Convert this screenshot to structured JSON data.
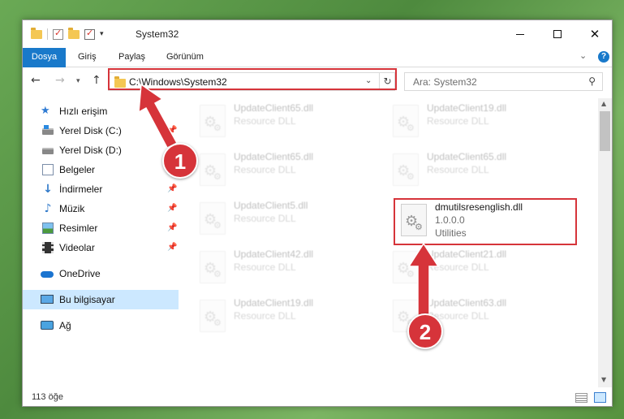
{
  "titlebar": {
    "title": "System32"
  },
  "ribbon": {
    "tabs": [
      "Dosya",
      "Giriş",
      "Paylaş",
      "Görünüm"
    ],
    "help": "?"
  },
  "address": {
    "path": "C:\\Windows\\System32"
  },
  "search": {
    "placeholder": "Ara: System32"
  },
  "sidebar": {
    "items": [
      {
        "label": "Hızlı erişim"
      },
      {
        "label": "Yerel Disk (C:)"
      },
      {
        "label": "Yerel Disk (D:)"
      },
      {
        "label": "Belgeler"
      },
      {
        "label": "İndirmeler"
      },
      {
        "label": "Müzik"
      },
      {
        "label": "Resimler"
      },
      {
        "label": "Videolar"
      },
      {
        "label": "OneDrive"
      },
      {
        "label": "Bu bilgisayar"
      },
      {
        "label": "Ağ"
      }
    ]
  },
  "files": [
    {
      "name": "UpdateClient65.dll",
      "desc": "Resource DLL"
    },
    {
      "name": "UpdateClient19.dll",
      "desc": "Resource DLL"
    },
    {
      "name": "UpdateClient65.dll",
      "desc": "Resource DLL"
    },
    {
      "name": "UpdateClient65.dll",
      "desc": "Resource DLL"
    },
    {
      "name": "UpdateClient5.dll",
      "desc": "Resource DLL"
    },
    {
      "name": "dmutilsresenglish.dll",
      "desc": "1.0.0.0",
      "desc2": "Utilities"
    },
    {
      "name": "UpdateClient42.dll",
      "desc": "Resource DLL"
    },
    {
      "name": "UpdateClient21.dll",
      "desc": "Resource DLL"
    },
    {
      "name": "UpdateClient19.dll",
      "desc": "Resource DLL"
    },
    {
      "name": "UpdateClient63.dll",
      "desc": "Resource DLL"
    }
  ],
  "status": {
    "count": "113 öğe"
  },
  "annotations": {
    "badge1": "1",
    "badge2": "2"
  },
  "colors": {
    "accent": "#1979ca",
    "highlight": "#d6343a",
    "selected": "#cce8ff"
  }
}
